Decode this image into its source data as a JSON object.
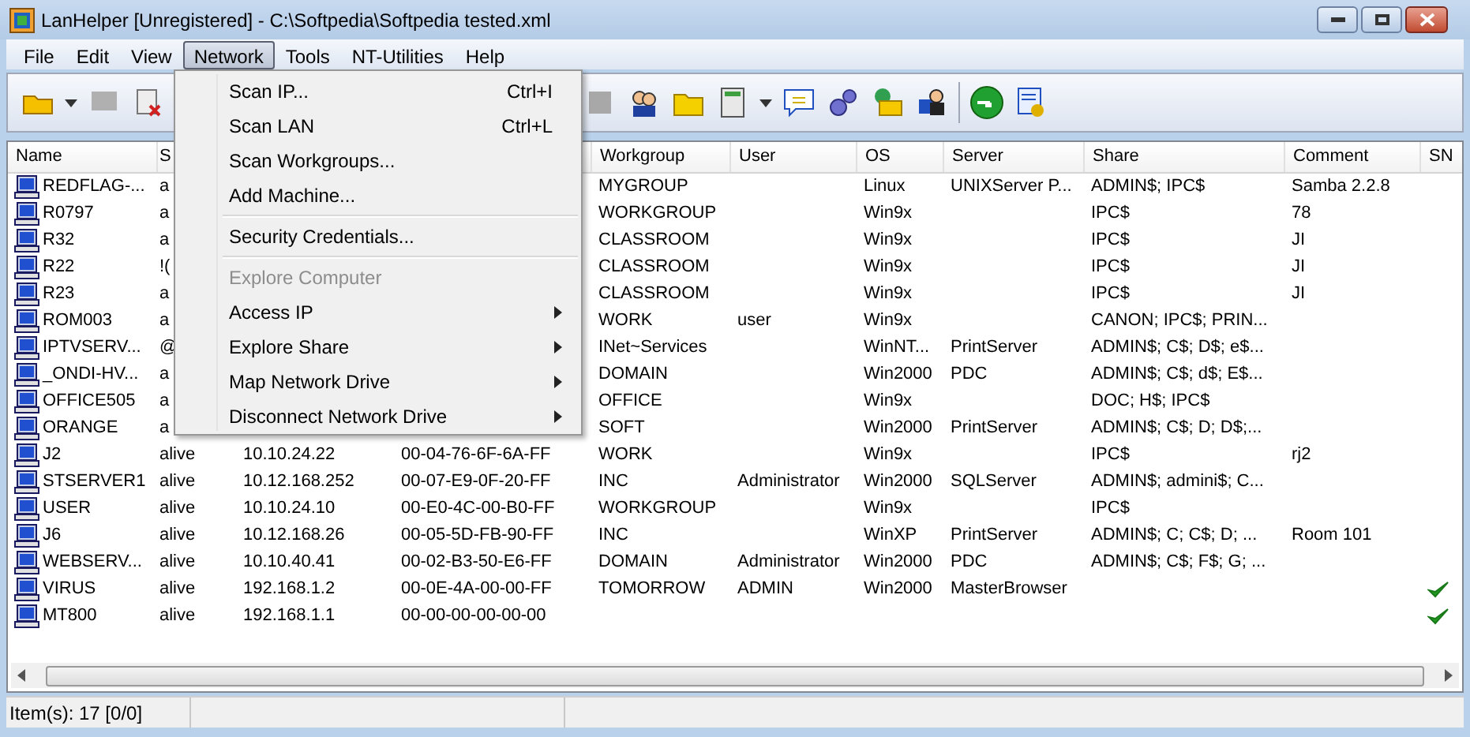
{
  "window": {
    "title": "LanHelper [Unregistered] - C:\\Softpedia\\Softpedia tested.xml"
  },
  "menubar": [
    {
      "label": "File",
      "selected": false
    },
    {
      "label": "Edit",
      "selected": false
    },
    {
      "label": "View",
      "selected": false
    },
    {
      "label": "Network",
      "selected": true
    },
    {
      "label": "Tools",
      "selected": false
    },
    {
      "label": "NT-Utilities",
      "selected": false
    },
    {
      "label": "Help",
      "selected": false
    }
  ],
  "network_menu": [
    {
      "kind": "command",
      "label": "Scan IP...",
      "shortcut": "Ctrl+I",
      "disabled": false
    },
    {
      "kind": "command",
      "label": "Scan LAN",
      "shortcut": "Ctrl+L",
      "disabled": false
    },
    {
      "kind": "command",
      "label": "Scan Workgroups...",
      "disabled": false
    },
    {
      "kind": "command",
      "label": "Add Machine...",
      "disabled": false
    },
    {
      "kind": "separator"
    },
    {
      "kind": "command",
      "label": "Security Credentials...",
      "disabled": false
    },
    {
      "kind": "separator"
    },
    {
      "kind": "command",
      "label": "Explore Computer",
      "disabled": true
    },
    {
      "kind": "submenu",
      "label": "Access IP",
      "disabled": false
    },
    {
      "kind": "submenu",
      "label": "Explore Share",
      "disabled": false
    },
    {
      "kind": "submenu",
      "label": "Map Network Drive",
      "disabled": false
    },
    {
      "kind": "submenu",
      "label": "Disconnect Network Drive",
      "disabled": false
    }
  ],
  "table": {
    "columns": [
      "Name",
      "S",
      "",
      "",
      "Workgroup",
      "User",
      "OS",
      "Server",
      "Share",
      "Comment",
      "SN"
    ],
    "rows": [
      {
        "name": "REDFLAG-...",
        "status": "a",
        "workgroup": "MYGROUP",
        "os": "Linux",
        "server": "UNIXServer P...",
        "share": "ADMIN$; IPC$",
        "comment": "Samba 2.2.8",
        "sn_checked": false
      },
      {
        "name": "R0797",
        "status": "a",
        "workgroup": "WORKGROUP",
        "os": "Win9x",
        "share": "IPC$",
        "comment": "78",
        "sn_checked": false
      },
      {
        "name": "R32",
        "status": "a",
        "workgroup": "CLASSROOM",
        "os": "Win9x",
        "share": "IPC$",
        "comment": "JI",
        "sn_checked": false
      },
      {
        "name": "R22",
        "status": "!(",
        "workgroup": "CLASSROOM",
        "os": "Win9x",
        "share": "IPC$",
        "comment": "JI",
        "sn_checked": false
      },
      {
        "name": "R23",
        "status": "a",
        "workgroup": "CLASSROOM",
        "os": "Win9x",
        "share": "IPC$",
        "comment": "JI",
        "sn_checked": false
      },
      {
        "name": "ROM003",
        "status": "a",
        "workgroup": "WORK",
        "user": "user",
        "os": "Win9x",
        "share": "CANON; IPC$; PRIN...",
        "sn_checked": false
      },
      {
        "name": "IPTVSERV...",
        "status": "@",
        "workgroup": "INet~Services",
        "os": "WinNT...",
        "server": "PrintServer",
        "share": "ADMIN$; C$; D$; e$...",
        "sn_checked": false
      },
      {
        "name": "_ONDI-HV...",
        "status": "a",
        "workgroup": "DOMAIN",
        "os": "Win2000",
        "server": "PDC",
        "share": "ADMIN$; C$; d$; E$...",
        "sn_checked": false
      },
      {
        "name": "OFFICE505",
        "status": "a",
        "workgroup": "OFFICE",
        "os": "Win9x",
        "share": "DOC; H$; IPC$",
        "sn_checked": false
      },
      {
        "name": "ORANGE",
        "status": "a",
        "workgroup": "SOFT",
        "os": "Win2000",
        "server": "PrintServer",
        "share": "ADMIN$; C$; D; D$;...",
        "sn_checked": false
      },
      {
        "name": "J2",
        "status": "alive",
        "ip": "10.10.24.22",
        "mac": "00-04-76-6F-6A-FF",
        "workgroup": "WORK",
        "os": "Win9x",
        "share": "IPC$",
        "comment": "rj2",
        "sn_checked": false
      },
      {
        "name": "STSERVER1",
        "status": "alive",
        "ip": "10.12.168.252",
        "mac": "00-07-E9-0F-20-FF",
        "workgroup": "INC",
        "user": "Administrator",
        "os": "Win2000",
        "server": "SQLServer",
        "share": "ADMIN$; admini$; C...",
        "sn_checked": false
      },
      {
        "name": "USER",
        "status": "alive",
        "ip": "10.10.24.10",
        "mac": "00-E0-4C-00-B0-FF",
        "workgroup": "WORKGROUP",
        "os": "Win9x",
        "share": "IPC$",
        "sn_checked": false
      },
      {
        "name": "J6",
        "status": "alive",
        "ip": "10.12.168.26",
        "mac": "00-05-5D-FB-90-FF",
        "workgroup": "INC",
        "os": "WinXP",
        "server": "PrintServer",
        "share": "ADMIN$; C; C$; D; ...",
        "comment": "Room 101",
        "sn_checked": false
      },
      {
        "name": "WEBSERV...",
        "status": "alive",
        "ip": "10.10.40.41",
        "mac": "00-02-B3-50-E6-FF",
        "workgroup": "DOMAIN",
        "user": "Administrator",
        "os": "Win2000",
        "server": "PDC",
        "share": "ADMIN$; C$; F$; G; ...",
        "sn_checked": false
      },
      {
        "name": "VIRUS",
        "status": "alive",
        "ip": "192.168.1.2",
        "mac": "00-0E-4A-00-00-FF",
        "workgroup": "TOMORROW",
        "user": "ADMIN",
        "os": "Win2000",
        "server": "MasterBrowser",
        "sn_checked": true
      },
      {
        "name": "MT800",
        "status": "alive",
        "ip": "192.168.1.1",
        "mac": "00-00-00-00-00-00",
        "sn_checked": true
      }
    ]
  },
  "status_bar": {
    "items": "Item(s): 17 [0/0]"
  }
}
